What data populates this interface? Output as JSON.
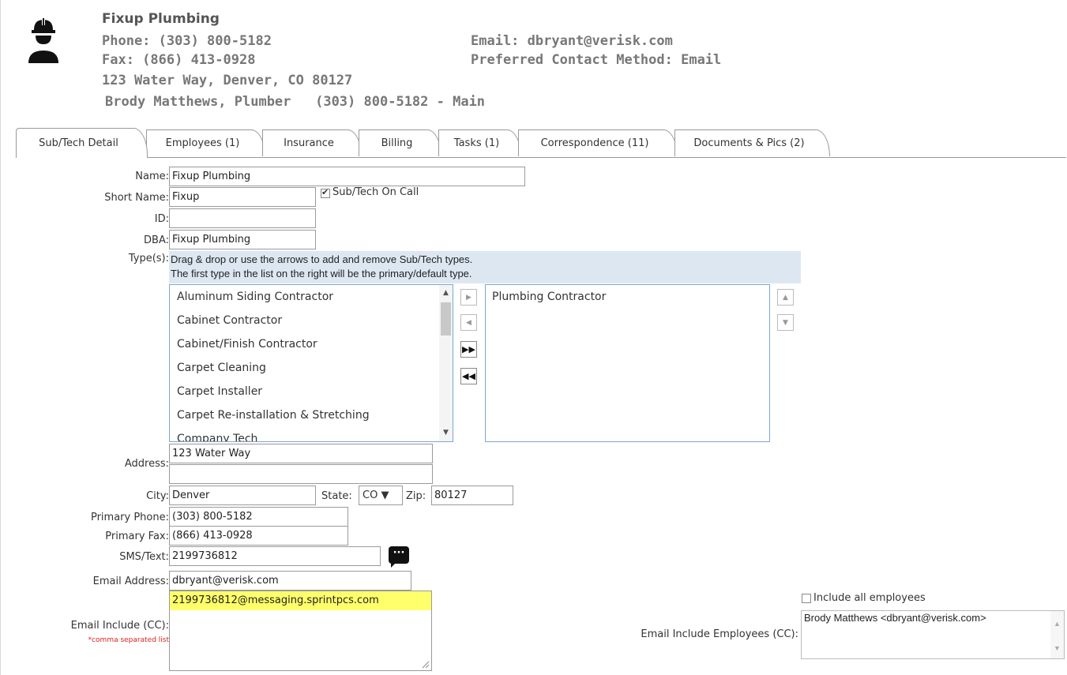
{
  "header": {
    "company_name": "Fixup Plumbing",
    "phone": "Phone: (303) 800-5182",
    "fax": "Fax: (866) 413-0928",
    "address": "123 Water Way, Denver, CO 80127",
    "contact": "Brody Matthews, Plumber   (303) 800-5182 - Main",
    "email": "Email: dbryant@verisk.com",
    "preferred_contact": "Preferred Contact Method: Email",
    "icon": "construction-worker-icon"
  },
  "tabs": [
    {
      "label": "Sub/Tech Detail",
      "active": true
    },
    {
      "label": "Employees (1)"
    },
    {
      "label": "Insurance"
    },
    {
      "label": "Billing"
    },
    {
      "label": "Tasks (1)"
    },
    {
      "label": "Correspondence (11)"
    },
    {
      "label": "Documents & Pics (2)"
    }
  ],
  "form": {
    "name_label": "Name:",
    "name_value": "Fixup Plumbing",
    "short_name_label": "Short Name:",
    "short_name_value": "Fixup",
    "on_call_label": "Sub/Tech On Call",
    "on_call_checked": true,
    "id_label": "ID:",
    "id_value": "",
    "dba_label": "DBA:",
    "dba_value": "Fixup Plumbing",
    "types_label": "Type(s):",
    "types_help_1": "Drag & drop or use the arrows to add and remove Sub/Tech types.",
    "types_help_2": "The first type in the list on the right will be the primary/default type.",
    "available_types": [
      "Aluminum Siding Contractor",
      "Cabinet Contractor",
      "Cabinet/Finish Contractor",
      "Carpet Cleaning",
      "Carpet Installer",
      "Carpet Re-installation & Stretching",
      "Company Tech"
    ],
    "selected_types": [
      "Plumbing Contractor"
    ],
    "address_label": "Address:",
    "address_line1": "123 Water Way",
    "address_line2": "",
    "city_label": "City:",
    "city_value": "Denver",
    "state_label": "State:",
    "state_value": "CO ▼",
    "zip_label": "Zip:",
    "zip_value": "80127",
    "primary_phone_label": "Primary Phone:",
    "primary_phone_value": "(303) 800-5182",
    "primary_fax_label": "Primary Fax:",
    "primary_fax_value": "(866) 413-0928",
    "sms_label": "SMS/Text:",
    "sms_value": "2199736812",
    "email_label": "Email Address:",
    "email_value": "dbryant@verisk.com",
    "cc_label": "Email Include (CC):",
    "cc_note": "*comma separated list",
    "cc_value": "2199736812@messaging.sprintpcs.com",
    "include_all_label": "Include all employees",
    "include_all_checked": false,
    "emp_cc_label": "Email Include Employees (CC):",
    "emp_cc_value": "Brody Matthews <dbryant@verisk.com>"
  }
}
